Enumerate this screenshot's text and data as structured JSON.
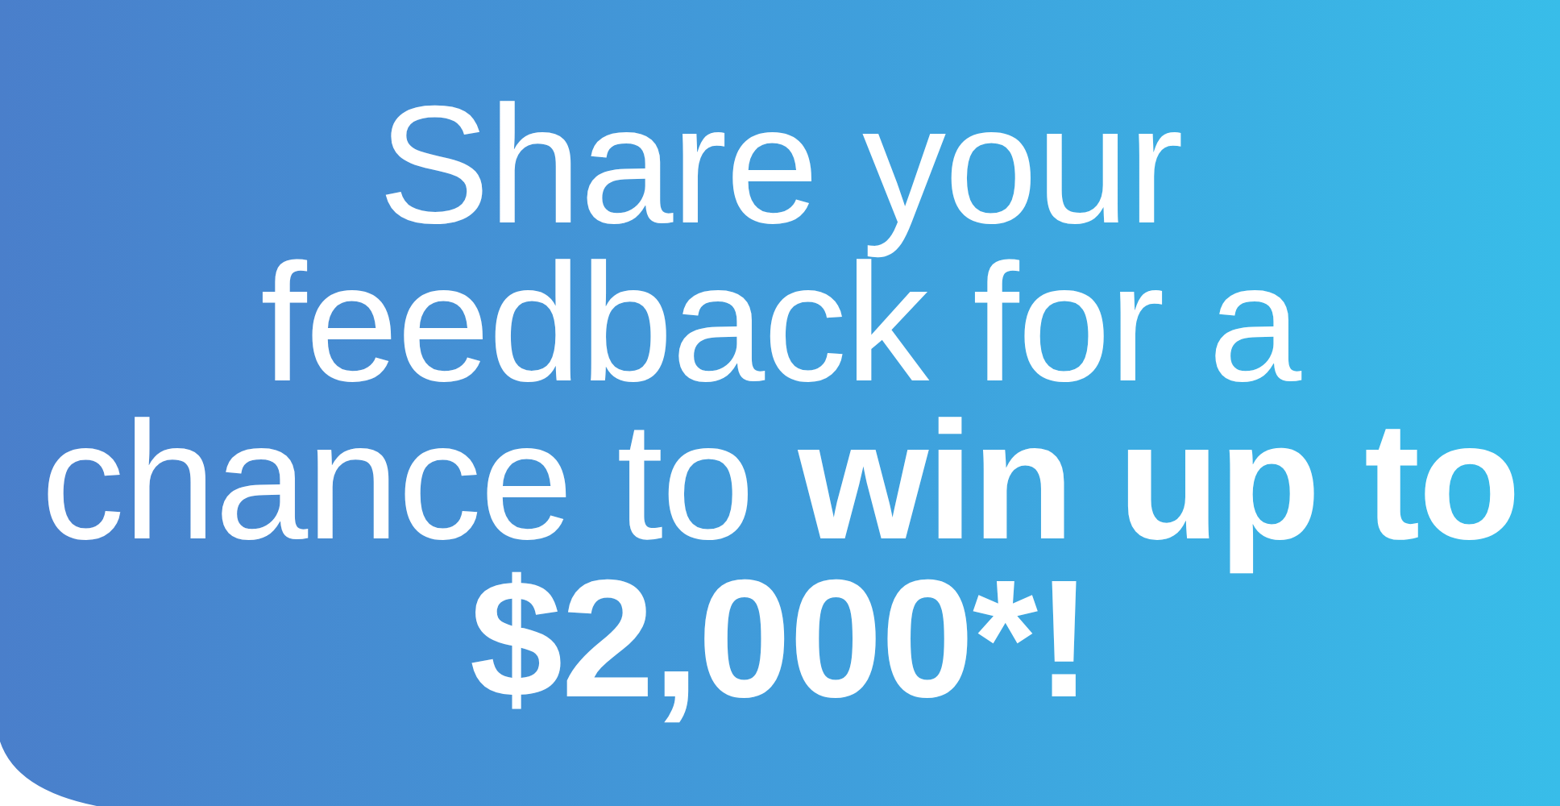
{
  "banner": {
    "headline": {
      "text": "Share your feedback for a chance to",
      "emphasis": "win up to $2,000*!"
    }
  }
}
